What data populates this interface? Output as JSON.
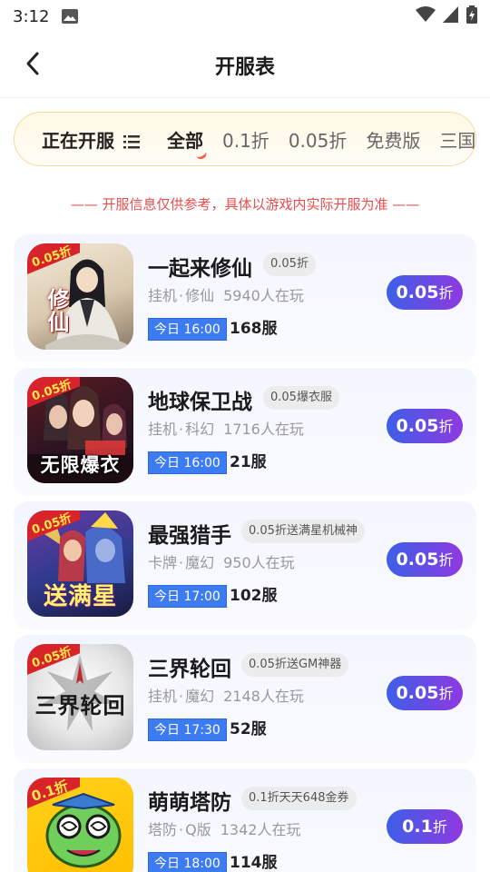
{
  "status_bar": {
    "time": "3:12",
    "icons": [
      "image-icon",
      "wifi-icon",
      "signal-icon",
      "battery-icon"
    ]
  },
  "header": {
    "title": "开服表",
    "back_icon": "chevron-left-icon"
  },
  "filter_bar": {
    "now_label": "正在开服",
    "tabs": [
      {
        "label": "全部",
        "active": true
      },
      {
        "label": "0.1折",
        "active": false
      },
      {
        "label": "0.05折",
        "active": false
      },
      {
        "label": "免费版",
        "active": false
      },
      {
        "label": "三国",
        "active": false
      }
    ]
  },
  "notice": "—— 开服信息仅供参考，具体以游戏内实际开服为准 ——",
  "colors": {
    "accent_blue": "#3d7bf0",
    "button_gradient_start": "#3e5fe8",
    "button_gradient_end": "#8e39e0",
    "notice_red": "#e84c4c",
    "filter_border": "#f4dca0"
  },
  "servers": [
    {
      "name": "一起来修仙",
      "tag": "0.05折",
      "genre1": "挂机",
      "genre2": "修仙",
      "players": "5940人在玩",
      "time": "今日 16:00",
      "server_no": "168服",
      "discount_value": "0.05",
      "discount_unit": "折",
      "icon_badge": "0.05折",
      "icon_caption": "修仙",
      "icon_name": "game-icon-yiqilaixiuxian"
    },
    {
      "name": "地球保卫战",
      "tag": "0.05爆衣服",
      "genre1": "挂机",
      "genre2": "科幻",
      "players": "1716人在玩",
      "time": "今日 16:00",
      "server_no": "21服",
      "discount_value": "0.05",
      "discount_unit": "折",
      "icon_badge": "0.05折",
      "icon_caption": "无限爆衣",
      "icon_name": "game-icon-diqiubaoweizhan"
    },
    {
      "name": "最强猎手",
      "tag": "0.05折送满星机械神",
      "genre1": "卡牌",
      "genre2": "魔幻",
      "players": "950人在玩",
      "time": "今日 17:00",
      "server_no": "102服",
      "discount_value": "0.05",
      "discount_unit": "折",
      "icon_badge": "0.05折",
      "icon_caption": "送满星",
      "icon_name": "game-icon-zuiqianglieshou"
    },
    {
      "name": "三界轮回",
      "tag": "0.05折送GM神器",
      "genre1": "挂机",
      "genre2": "魔幻",
      "players": "2148人在玩",
      "time": "今日 17:30",
      "server_no": "52服",
      "discount_value": "0.05",
      "discount_unit": "折",
      "icon_badge": "0.05折",
      "icon_caption": "三界轮回",
      "icon_name": "game-icon-sanjielunhui"
    },
    {
      "name": "萌萌塔防",
      "tag": "0.1折天天648金券",
      "genre1": "塔防",
      "genre2": "Q版",
      "players": "1342人在玩",
      "time": "今日 18:00",
      "server_no": "114服",
      "discount_value": "0.1",
      "discount_unit": "折",
      "icon_badge": "0.1折",
      "icon_caption": "",
      "icon_name": "game-icon-mengmengtafang"
    }
  ]
}
